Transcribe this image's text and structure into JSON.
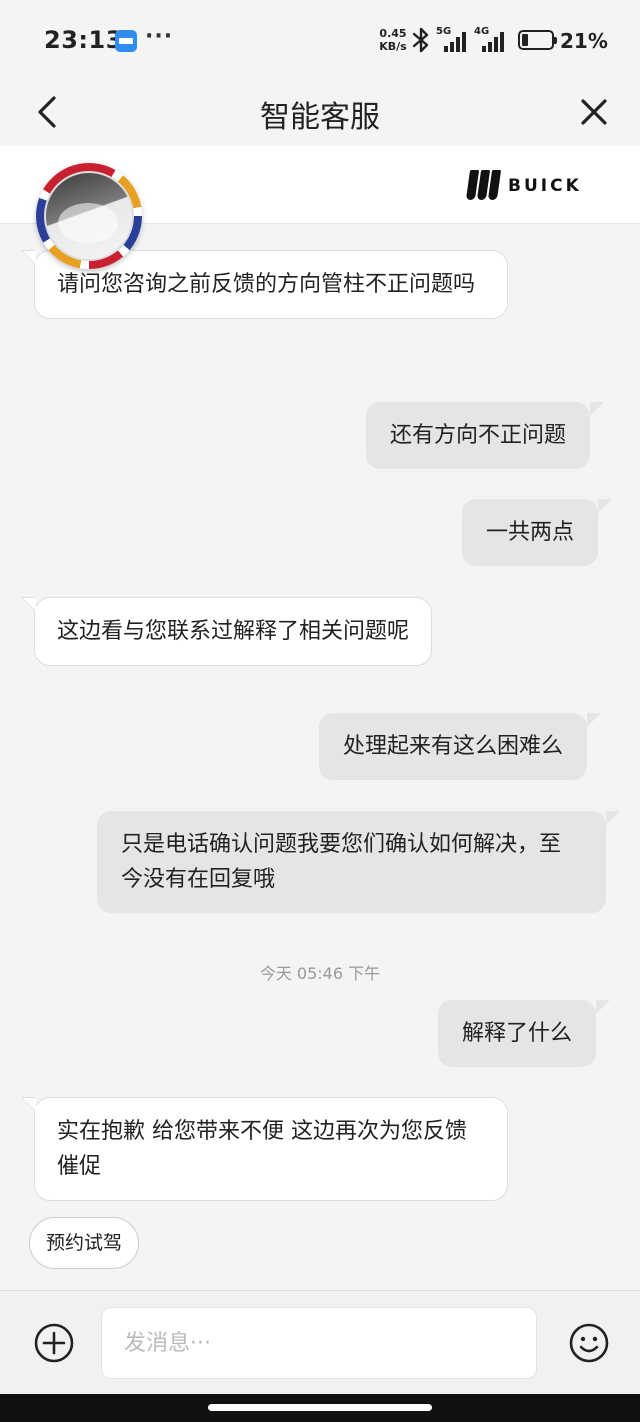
{
  "status_bar": {
    "time": "23:13",
    "more": "···",
    "net_speed_value": "0.45",
    "net_speed_unit": "KB/s",
    "sim1_type": "5G",
    "sim2_type": "4G",
    "battery_percent": "21%",
    "battery_level": 0.21
  },
  "header": {
    "title": "智能客服",
    "brand": "BUICK"
  },
  "messages": [
    {
      "side": "in",
      "text": "请问您咨询之前反馈的方向管柱不正问题吗"
    },
    {
      "side": "out",
      "text": "还有方向不正问题"
    },
    {
      "side": "out",
      "text": "一共两点"
    },
    {
      "side": "in",
      "text": "这边看与您联系过解释了相关问题呢"
    },
    {
      "side": "out",
      "text": "处理起来有这么困难么"
    },
    {
      "side": "out",
      "text": "只是电话确认问题我要您们确认如何解决，至今没有在回复哦"
    },
    {
      "side": "out",
      "text": "解释了什么"
    },
    {
      "side": "in",
      "text": "实在抱歉 给您带来不便 这边再次为您反馈催促"
    }
  ],
  "timestamp": "今天 05:46 下午",
  "quick_reply": "预约试驾",
  "input": {
    "placeholder": "发消息···"
  },
  "icons": {
    "back": "chevron-left-icon",
    "close": "close-icon",
    "add": "plus-circle-icon",
    "emoji": "smiley-icon",
    "bluetooth": "bluetooth-icon"
  }
}
